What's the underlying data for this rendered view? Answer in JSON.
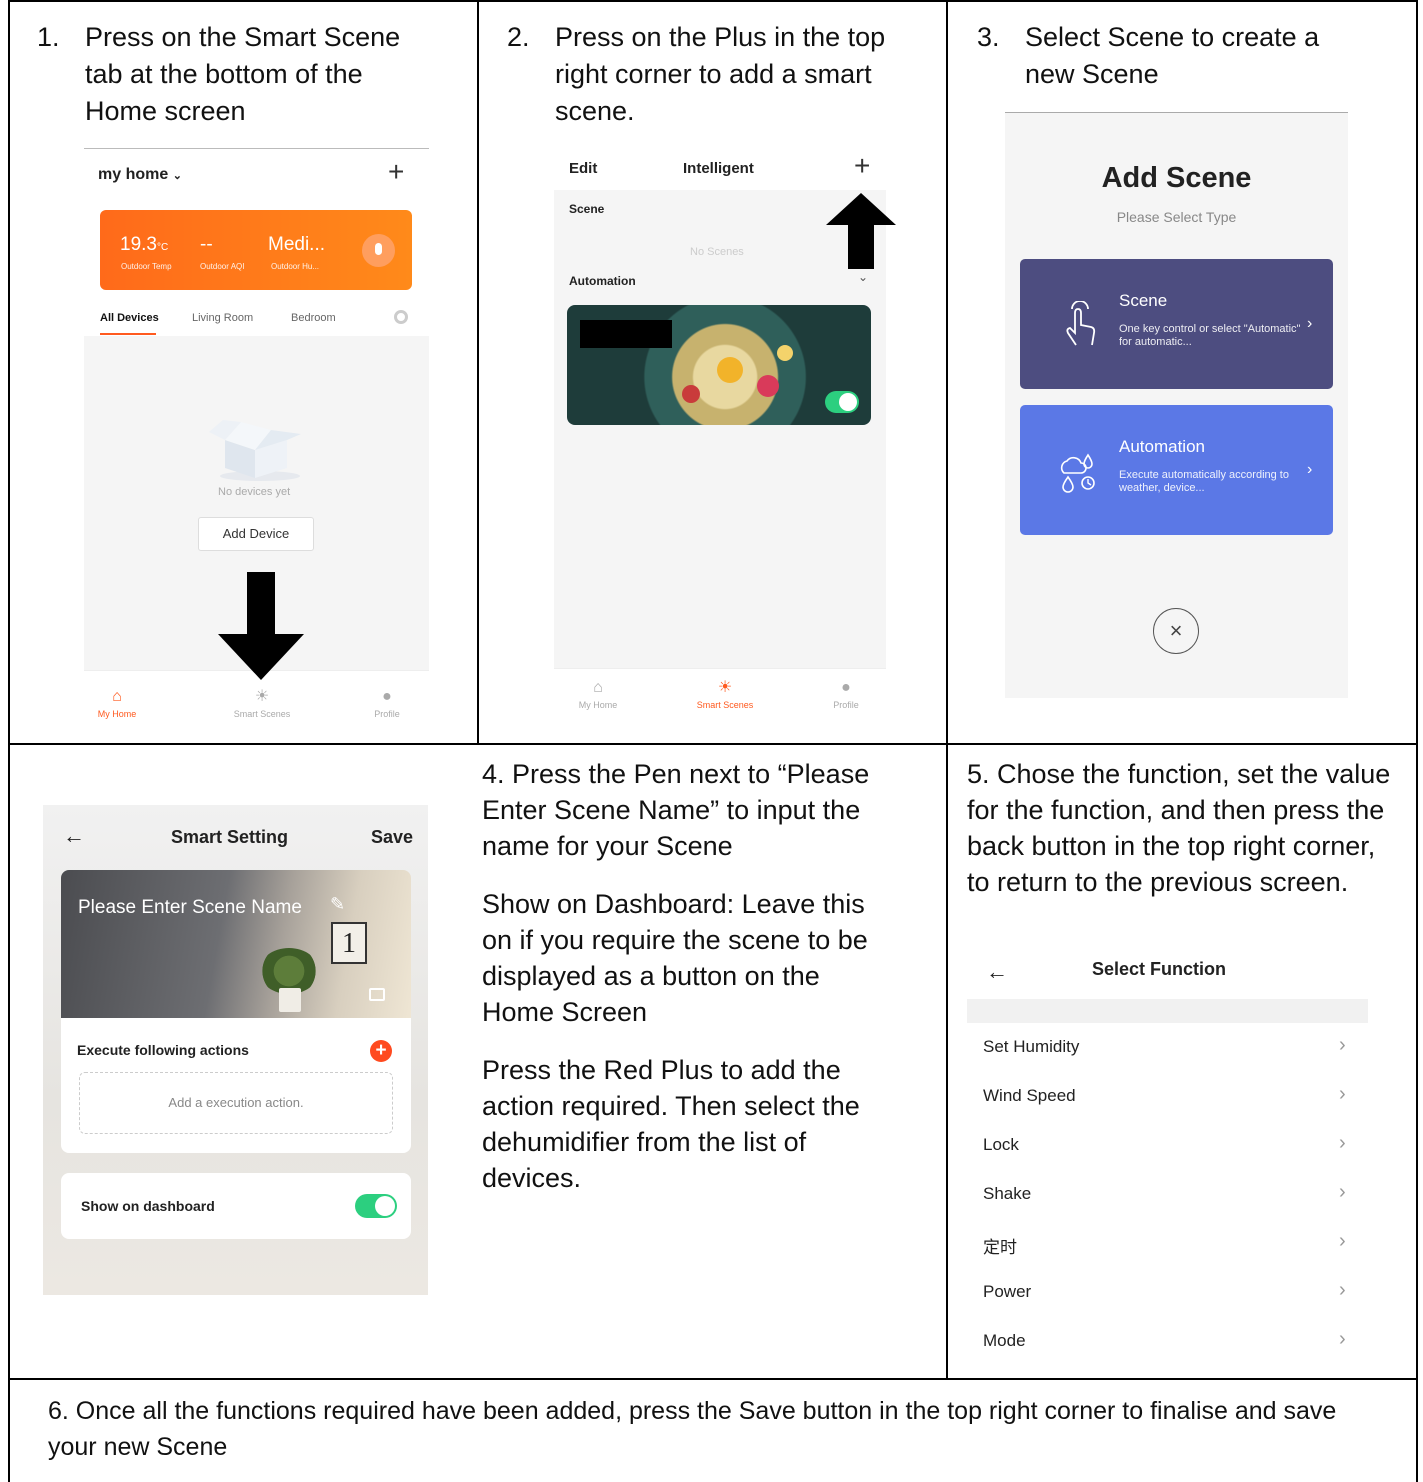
{
  "steps": {
    "s1": {
      "num": "1.",
      "text": "Press on the Smart Scene tab at the bottom of the Home screen"
    },
    "s2": {
      "num": "2.",
      "text": "Press on the Plus in the top right corner to add a smart scene."
    },
    "s3": {
      "num": "3.",
      "text": "Select Scene to create a new Scene"
    },
    "s4": {
      "p1": "4. Press the Pen next to “Please Enter Scene Name” to input the name for your Scene",
      "p2": "Show on Dashboard: Leave this on if you require the scene to be displayed as a button on the Home Screen",
      "p3": "Press the Red Plus to add the action required.  Then select the dehumidifier from the list of devices."
    },
    "s5": {
      "text": "5. Chose the function, set the value for the function, and then press the back button in the top right corner, to return to the previous screen."
    },
    "s6": {
      "text": "6.  Once all the functions required have been added, press the Save button in the top right corner to finalise and save your new Scene"
    }
  },
  "screen1": {
    "home_title": "my home",
    "weather": {
      "temp": "19.3",
      "temp_unit": "°C",
      "aqi": "--",
      "humidity": "Medi...",
      "temp_label": "Outdoor Temp",
      "aqi_label": "Outdoor AQI",
      "hum_label": "Outdoor Hu..."
    },
    "tabs": [
      "All Devices",
      "Living Room",
      "Bedroom"
    ],
    "empty_text": "No devices yet",
    "add_device": "Add Device",
    "tabbar": [
      "My Home",
      "Smart Scenes",
      "Profile"
    ]
  },
  "screen2": {
    "edit": "Edit",
    "title": "Intelligent",
    "scene_section": "Scene",
    "no_scenes": "No Scenes",
    "automation_section": "Automation",
    "tabbar": [
      "My Home",
      "Smart Scenes",
      "Profile"
    ]
  },
  "screen3": {
    "title": "Add Scene",
    "subtitle": "Please Select Type",
    "scene_card": {
      "title": "Scene",
      "desc": "One key control or select \"Automatic\" for automatic...",
      "color": "#4d4d80"
    },
    "automation_card": {
      "title": "Automation",
      "desc": "Execute automatically according to weather, device...",
      "color": "#5b78e6"
    }
  },
  "screen4": {
    "title": "Smart Setting",
    "save": "Save",
    "scene_name_placeholder": "Please Enter Scene Name",
    "calendar_digit": "1",
    "actions_title": "Execute following actions",
    "add_action": "Add a execution action.",
    "show_dashboard": "Show on dashboard"
  },
  "screen5": {
    "title": "Select Function",
    "functions": [
      "Set Humidity",
      "Wind Speed",
      "Lock",
      "Shake",
      "定时",
      "Power",
      "Mode"
    ]
  }
}
